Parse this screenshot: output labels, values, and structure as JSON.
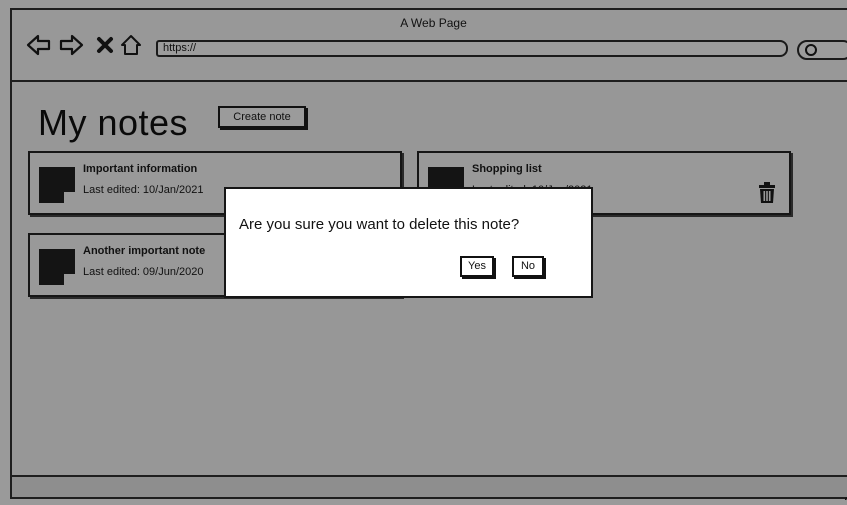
{
  "window": {
    "title": "A Web Page"
  },
  "browser": {
    "nav_icons": [
      "back-arrow-icon",
      "forward-arrow-icon",
      "stop-x-icon",
      "home-icon"
    ],
    "url": "https://",
    "search_icon": "magnifier-icon"
  },
  "page": {
    "title": "My notes",
    "create_button": "Create note"
  },
  "notes": [
    {
      "title": "Important information",
      "date": "Last edited: 10/Jan/2021"
    },
    {
      "title": "Shopping list",
      "date": "Last edited: 10/Jan/2021"
    },
    {
      "title": "Another important note",
      "date": "Last edited: 09/Jun/2020"
    }
  ],
  "dialog": {
    "message": "Are you sure you want to delete this note?",
    "yes_label": "Yes",
    "no_label": "No"
  },
  "colors": {
    "overlay_bg": "#989898",
    "dialog_bg": "#ffffff",
    "ink": "#111111"
  }
}
